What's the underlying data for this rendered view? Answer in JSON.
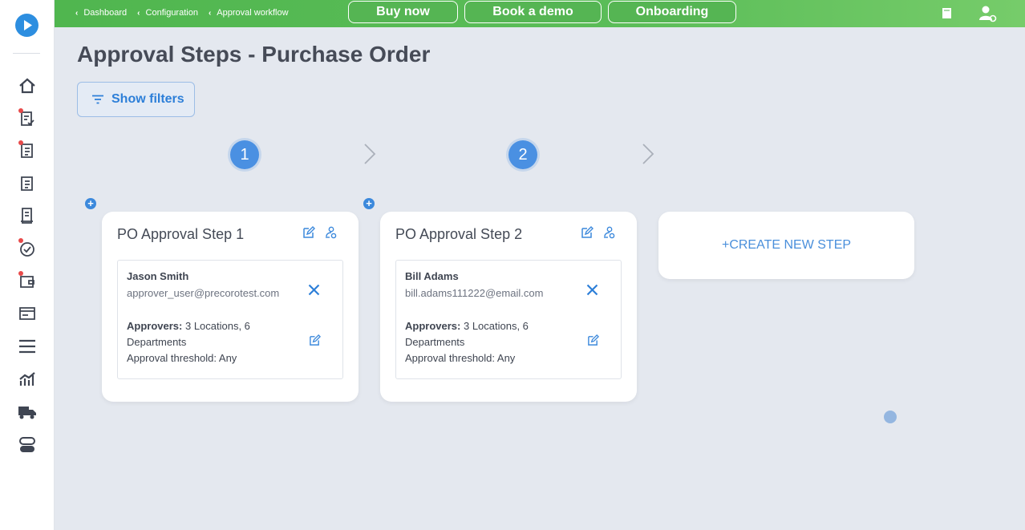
{
  "breadcrumbs": [
    "Dashboard",
    "Configuration",
    "Approval workflow"
  ],
  "topbar": {
    "buy_now": "Buy now",
    "book_demo": "Book a demo",
    "onboarding": "Onboarding"
  },
  "page": {
    "title": "Approval Steps - Purchase Order",
    "filter_label": "Show filters"
  },
  "steps": [
    {
      "number": "1",
      "title": "PO Approval Step 1",
      "approver": {
        "name": "Jason Smith",
        "email": "approver_user@precorotest.com",
        "approvers_label": "Approvers:",
        "approvers_value": " 3 Locations, 6 Departments",
        "threshold": "Approval threshold: Any"
      }
    },
    {
      "number": "2",
      "title": "PO Approval Step 2",
      "approver": {
        "name": "Bill Adams",
        "email": "bill.adams111222@email.com",
        "approvers_label": "Approvers:",
        "approvers_value": " 3 Locations, 6 Departments",
        "threshold": "Approval threshold: Any"
      }
    }
  ],
  "create_step_label": "+CREATE NEW STEP",
  "add_symbol": "+",
  "colors": {
    "accent_blue": "#4a90e2",
    "topbar_green": "#5bbd58",
    "background": "#e4e8ef",
    "notification_red": "#e84a4a"
  },
  "icons": {
    "sidebar": [
      "home-icon",
      "requisitions-icon",
      "purchase-orders-icon",
      "invoices-icon",
      "receipts-icon",
      "approvals-icon",
      "wallet-icon",
      "payments-icon",
      "menu-icon",
      "analytics-icon",
      "delivery-icon",
      "settings-icon"
    ],
    "topbar": [
      "book-icon",
      "user-settings-icon"
    ]
  }
}
